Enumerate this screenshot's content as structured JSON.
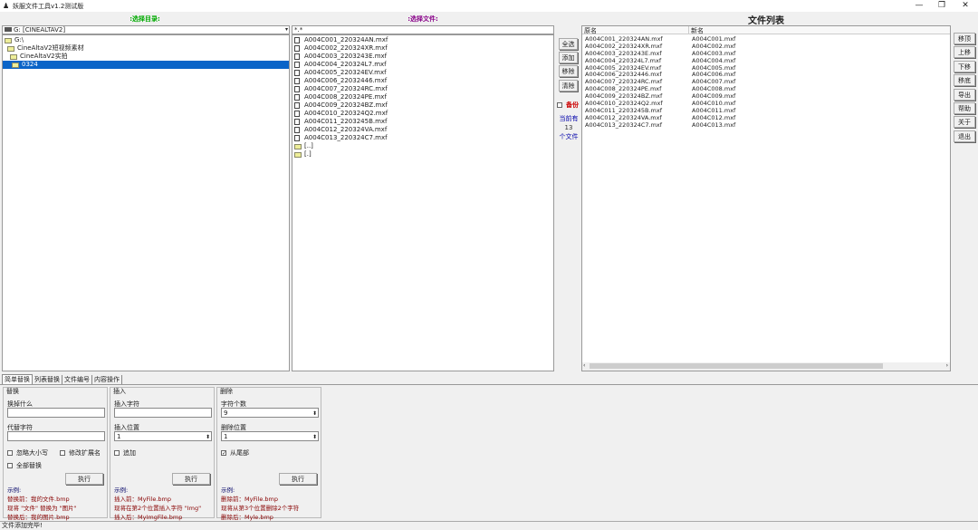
{
  "window": {
    "title": "妖服文件工具v1.2测试版",
    "minimize": "—",
    "restore": "❐",
    "close": "✕"
  },
  "left": {
    "header": ":选择目录:",
    "drive": "G: [CINEALTAV2]",
    "tree": [
      "G:\\",
      "CineAltaV2短视频素材",
      "CineAltaV2实拍",
      "0324"
    ]
  },
  "middle": {
    "header": ":选择文件:",
    "filter": "*.*",
    "files": [
      "A004C001_220324AN.mxf",
      "A004C002_220324XR.mxf",
      "A004C003_2203243E.mxf",
      "A004C004_220324L7.mxf",
      "A004C005_220324EV.mxf",
      "A004C006_22032446.mxf",
      "A004C007_220324RC.mxf",
      "A004C008_220324PE.mxf",
      "A004C009_220324BZ.mxf",
      "A004C010_220324Q2.mxf",
      "A004C011_2203245B.mxf",
      "A004C012_220324VA.mxf",
      "A004C013_220324C7.mxf"
    ],
    "dirs": [
      "[..]",
      "[.]"
    ]
  },
  "center_buttons": {
    "select_all": "全选",
    "add": "添加",
    "remove": "移除",
    "clear": "清除",
    "backup": "备份",
    "count_prefix": "当前有",
    "count": "13",
    "count_suffix": "个文件"
  },
  "right": {
    "title": "文件列表",
    "col_old": "原名",
    "col_new": "新名",
    "rows": [
      [
        "A004C001_220324AN.mxf",
        "A004C001.mxf"
      ],
      [
        "A004C002_220324XR.mxf",
        "A004C002.mxf"
      ],
      [
        "A004C003_2203243E.mxf",
        "A004C003.mxf"
      ],
      [
        "A004C004_220324L7.mxf",
        "A004C004.mxf"
      ],
      [
        "A004C005_220324EV.mxf",
        "A004C005.mxf"
      ],
      [
        "A004C006_22032446.mxf",
        "A004C006.mxf"
      ],
      [
        "A004C007_220324RC.mxf",
        "A004C007.mxf"
      ],
      [
        "A004C008_220324PE.mxf",
        "A004C008.mxf"
      ],
      [
        "A004C009_220324BZ.mxf",
        "A004C009.mxf"
      ],
      [
        "A004C010_220324Q2.mxf",
        "A004C010.mxf"
      ],
      [
        "A004C011_2203245B.mxf",
        "A004C011.mxf"
      ],
      [
        "A004C012_220324VA.mxf",
        "A004C012.mxf"
      ],
      [
        "A004C013_220324C7.mxf",
        "A004C013.mxf"
      ]
    ],
    "buttons": [
      "移顶",
      "上移",
      "下移",
      "移底",
      "导出",
      "帮助",
      "关于",
      "退出"
    ]
  },
  "tabs": [
    "简单替换",
    "列表替换",
    "文件编号",
    "内容操作"
  ],
  "replace": {
    "title": "替换",
    "find_label": "换掉什么",
    "find": "",
    "with_label": "代替字符",
    "with": "",
    "ignore_case": "忽略大小写",
    "change_ext": "修改扩展名",
    "replace_all": "全部替换",
    "run": "执行",
    "ex_title": "示例:",
    "ex1": "替换前：我的文件.bmp",
    "ex2": "现将 \"文件\" 替换为 \"图片\"",
    "ex3": "替换后：我的图片.bmp"
  },
  "insert": {
    "title": "插入",
    "chars_label": "插入字符",
    "chars": "",
    "pos_label": "插入位置",
    "pos": "1",
    "append": "追加",
    "run": "执行",
    "ex_title": "示例:",
    "ex1": "插入前：MyFile.bmp",
    "ex2": "现将在第2个位置插入字符 \"Img\"",
    "ex3": "插入后：MyImgFile.bmp"
  },
  "delete": {
    "title": "删除",
    "count_label": "字符个数",
    "count": "9",
    "pos_label": "删除位置",
    "pos": "1",
    "from_end": "从尾部",
    "run": "执行",
    "ex_title": "示例:",
    "ex1": "删除前：MyFile.bmp",
    "ex2": "现将从第3个位置删除2个字符",
    "ex3": "删除后：Myle.bmp"
  },
  "status": "文件添加完毕!"
}
